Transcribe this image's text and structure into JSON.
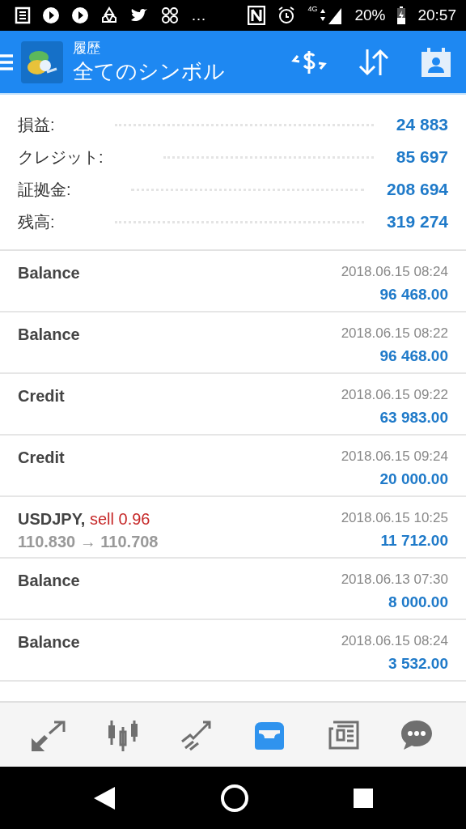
{
  "status_bar": {
    "overflow": "…",
    "network": "4G",
    "battery": "20%",
    "time": "20:57"
  },
  "header": {
    "subtitle": "履歴",
    "title": "全てのシンボル"
  },
  "summary": [
    {
      "label": "損益:",
      "value": "24 883"
    },
    {
      "label": "クレジット:",
      "value": "85 697"
    },
    {
      "label": "証拠金:",
      "value": "208 694"
    },
    {
      "label": "残高:",
      "value": "319 274"
    }
  ],
  "deals": [
    {
      "kind": "plain",
      "title": "Balance",
      "time": "2018.06.15 08:24",
      "amount": "96 468.00"
    },
    {
      "kind": "plain",
      "title": "Balance",
      "time": "2018.06.15 08:22",
      "amount": "96 468.00"
    },
    {
      "kind": "plain",
      "title": "Credit",
      "time": "2018.06.15 09:22",
      "amount": "63 983.00"
    },
    {
      "kind": "plain",
      "title": "Credit",
      "time": "2018.06.15 09:24",
      "amount": "20 000.00"
    },
    {
      "kind": "trade",
      "title": "USDJPY,",
      "action": "sell 0.96",
      "prices": "110.830 → 110.708",
      "time": "2018.06.15 10:25",
      "amount": "11 712.00"
    },
    {
      "kind": "plain",
      "title": "Balance",
      "time": "2018.06.13 07:30",
      "amount": "8 000.00"
    },
    {
      "kind": "plain",
      "title": "Balance",
      "time": "2018.06.15 08:24",
      "amount": "3 532.00"
    }
  ],
  "bottom_nav": [
    {
      "kind": "quotes",
      "selected": false
    },
    {
      "kind": "chart",
      "selected": false
    },
    {
      "kind": "trade",
      "selected": false
    },
    {
      "kind": "history",
      "selected": true
    },
    {
      "kind": "news",
      "selected": false
    },
    {
      "kind": "chat",
      "selected": false
    }
  ]
}
